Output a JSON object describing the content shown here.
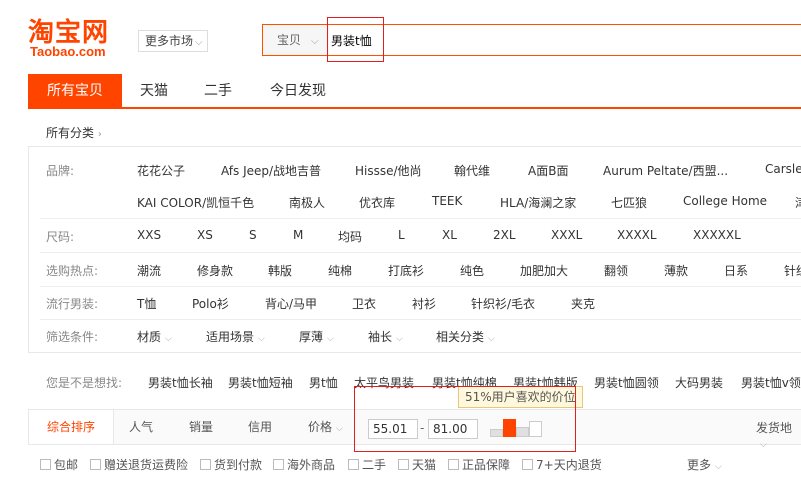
{
  "logo": {
    "cn": "淘宝网",
    "en": "Taobao.com"
  },
  "more_market": "更多市场",
  "search": {
    "category": "宝贝",
    "value": "男装t恤"
  },
  "tabs": [
    "所有宝贝",
    "天猫",
    "二手",
    "今日发现"
  ],
  "all_categories": "所有分类",
  "filters": {
    "brand": {
      "label": "品牌:",
      "row1": [
        "花花公子",
        "Afs Jeep/战地吉普",
        "Hissse/他尚",
        "翰代维",
        "A面B面",
        "Aurum Peltate/西盟...",
        "Carsle"
      ],
      "row2": [
        "KAI COLOR/凯恒千色",
        "南极人",
        "优衣库",
        "TEEK",
        "HLA/海澜之家",
        "七匹狼",
        "College Home",
        "津"
      ]
    },
    "size": {
      "label": "尺码:",
      "values": [
        "XXS",
        "XS",
        "S",
        "M",
        "均码",
        "L",
        "XL",
        "2XL",
        "XXXL",
        "XXXXL",
        "XXXXXL"
      ]
    },
    "hot": {
      "label": "选购热点:",
      "values": [
        "潮流",
        "修身款",
        "韩版",
        "纯棉",
        "打底衫",
        "纯色",
        "加肥加大",
        "翻领",
        "薄款",
        "日系",
        "针织"
      ]
    },
    "popular": {
      "label": "流行男装:",
      "values": [
        "T恤",
        "Polo衫",
        "背心/马甲",
        "卫衣",
        "衬衫",
        "针织衫/毛衣",
        "夹克"
      ]
    },
    "conditions": {
      "label": "筛选条件:",
      "values": [
        "材质",
        "适用场景",
        "厚薄",
        "袖长",
        "相关分类"
      ]
    }
  },
  "suggestions": {
    "label": "您是不是想找:",
    "values": [
      "男装t恤长袖",
      "男装t恤短袖",
      "男t恤",
      "太平鸟男装",
      "男装t恤纯棉",
      "男装t恤韩版",
      "男装t恤圆领",
      "大码男装",
      "男装t恤v领"
    ]
  },
  "sort": {
    "items": [
      "综合排序",
      "人气",
      "销量",
      "信用",
      "价格"
    ],
    "price_min": "55.01",
    "price_max": "81.00",
    "dash": "-",
    "tooltip": "51%用户喜欢的价位",
    "ship_from": "发货地"
  },
  "checkboxes": [
    "包邮",
    "赠送退货运费险",
    "货到付款",
    "海外商品",
    "二手",
    "天猫",
    "正品保障",
    "7+天内退货"
  ],
  "more": "更多",
  "colors": {
    "accent": "#ff4400",
    "highlight_box": "#e02020"
  }
}
